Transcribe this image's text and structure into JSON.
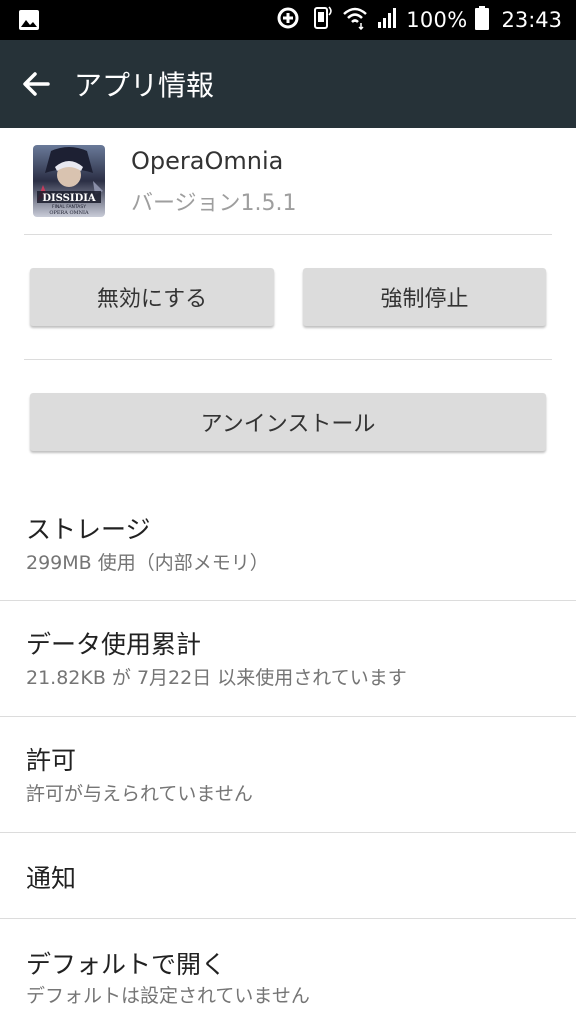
{
  "status_bar": {
    "battery": "100%",
    "time": "23:43",
    "icons": [
      "image-icon",
      "data-saver-icon",
      "vibrate-icon",
      "wifi-icon",
      "signal-icon",
      "battery-icon"
    ]
  },
  "app_bar": {
    "title": "アプリ情報",
    "background": "#263238"
  },
  "app": {
    "name": "OperaOmnia",
    "version": "バージョン1.5.1",
    "icon_text_main": "DISSIDIA",
    "icon_text_sub": "FINAL FANTASY",
    "icon_text_bottom": "OPERA OMNIA"
  },
  "buttons": {
    "disable": "無効にする",
    "force_stop": "強制停止",
    "uninstall": "アンインストール"
  },
  "rows": [
    {
      "title": "ストレージ",
      "subtitle": "299MB 使用（内部メモリ）"
    },
    {
      "title": "データ使用累計",
      "subtitle": "21.82KB が 7月22日 以来使用されています"
    },
    {
      "title": "許可",
      "subtitle": "許可が与えられていません"
    },
    {
      "title": "通知",
      "subtitle": ""
    },
    {
      "title": "デフォルトで開く",
      "subtitle": "デフォルトは設定されていません"
    }
  ]
}
